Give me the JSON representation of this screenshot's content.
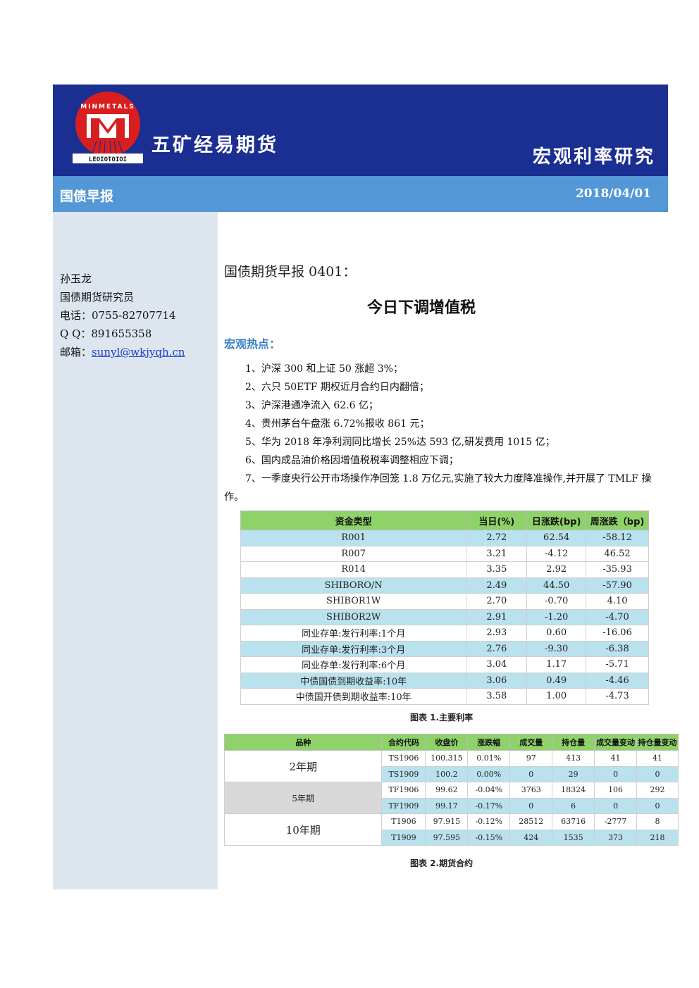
{
  "header": {
    "company": "五矿经易期货",
    "dept": "宏观利率研究",
    "logo_ring_text": "MINMETALS",
    "logo_band_text": "LEOIOTOIOI"
  },
  "subband": {
    "left": "国债早报",
    "right": "2018/04/01"
  },
  "sidebar": {
    "name": "孙玉龙",
    "role": "国债期货研究员",
    "phone": "电话：0755-82707714",
    "qq": "Q Q：891655358",
    "email_label": "邮箱：",
    "email": "sunyl@wkjyqh.cn"
  },
  "main": {
    "title1": "国债期货早报 0401：",
    "title2": "今日下调增值税",
    "hot_label": "宏观热点：",
    "bullets": [
      "1、沪深 300 和上证 50 涨超 3%；",
      "2、六只 50ETF 期权近月合约日内翻倍；",
      "3、沪深港通净流入 62.6 亿；",
      "4、贵州茅台午盘涨 6.72%报收 861 元；",
      "5、华为 2018 年净利润同比增长 25%达 593 亿,研发费用 1015 亿；",
      "6、国内成品油价格因增值税税率调整相应下调；"
    ],
    "bullet7_a": "7、一季度央行公开市场操作净回笼 1.8 万亿元,实施了较大力度降准操作,并开展了 TMLF 操",
    "bullet7_b": "作。"
  },
  "table1": {
    "headers": [
      "资金类型",
      "当日(%)",
      "日涨跌(bp)",
      "周涨跌（bp)"
    ],
    "rows": [
      [
        "R001",
        "2.72",
        "62.54",
        "-58.12"
      ],
      [
        "R007",
        "3.21",
        "-4.12",
        "46.52"
      ],
      [
        "R014",
        "3.35",
        "2.92",
        "-35.93"
      ],
      [
        "SHIBORO/N",
        "2.49",
        "44.50",
        "-57.90"
      ],
      [
        "SHIBOR1W",
        "2.70",
        "-0.70",
        "4.10"
      ],
      [
        "SHIBOR2W",
        "2.91",
        "-1.20",
        "-4.70"
      ],
      [
        "同业存单:发行利率:1个月",
        "2.93",
        "0.60",
        "-16.06"
      ],
      [
        "同业存单:发行利率:3个月",
        "2.76",
        "-9.30",
        "-6.38"
      ],
      [
        "同业存单:发行利率:6个月",
        "3.04",
        "1.17",
        "-5.71"
      ],
      [
        "中债国债到期收益率:10年",
        "3.06",
        "0.49",
        "-4.46"
      ],
      [
        "中债国开债到期收益率:10年",
        "3.58",
        "1.00",
        "-4.73"
      ]
    ],
    "caption": "图表 1.主要利率"
  },
  "table2": {
    "headers": [
      "品种",
      "合约代码",
      "收盘价",
      "涨跌幅",
      "成交量",
      "持仓量",
      "成交量变动",
      "持仓量变动"
    ],
    "groups": [
      {
        "name": "2年期",
        "rows": [
          [
            "TS1906",
            "100.315",
            "0.01%",
            "97",
            "413",
            "41",
            "41"
          ],
          [
            "TS1909",
            "100.2",
            "0.00%",
            "0",
            "29",
            "0",
            "0"
          ]
        ]
      },
      {
        "name": "5年期",
        "rows": [
          [
            "TF1906",
            "99.62",
            "-0.04%",
            "3763",
            "18324",
            "106",
            "292"
          ],
          [
            "TF1909",
            "99.17",
            "-0.17%",
            "0",
            "6",
            "0",
            "0"
          ]
        ]
      },
      {
        "name": "10年期",
        "rows": [
          [
            "T1906",
            "97.915",
            "-0.12%",
            "28512",
            "63716",
            "-2777",
            "8"
          ],
          [
            "T1909",
            "97.595",
            "-0.15%",
            "424",
            "1535",
            "373",
            "218"
          ]
        ]
      }
    ],
    "caption": "图表 2.期货合约"
  },
  "colors": {
    "header_bg": "#1b2e92",
    "subband_bg": "#5497d6",
    "sidebar_bg": "#dde6ef",
    "table_header_green": "#8fd26a",
    "row_blue": "#b9e1ee",
    "logo_red": "#d81e1e",
    "accent_blue_text": "#3c82c8"
  }
}
